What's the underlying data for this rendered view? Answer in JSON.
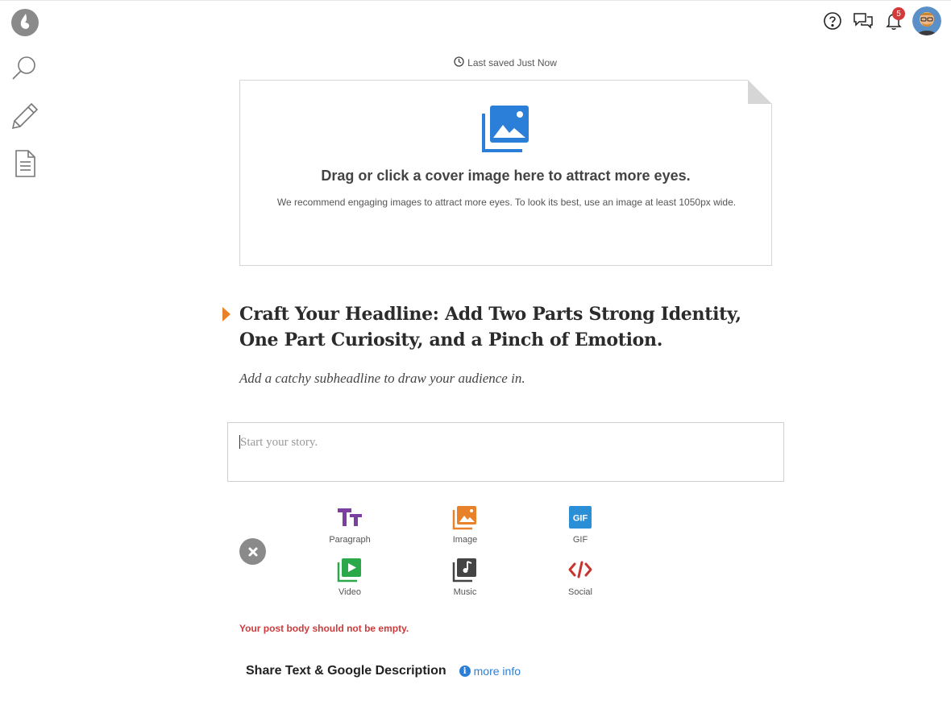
{
  "rail": {
    "items": [
      {
        "name": "logo",
        "icon": "flame-logo-icon"
      },
      {
        "name": "search",
        "icon": "search-icon"
      },
      {
        "name": "write",
        "icon": "pencil-icon"
      },
      {
        "name": "posts",
        "icon": "document-icon"
      }
    ]
  },
  "topbar": {
    "help_icon": "help-circle-icon",
    "messages_icon": "chat-bubbles-icon",
    "notifications_icon": "bell-icon",
    "notification_count": "5",
    "avatar_icon": "user-avatar"
  },
  "editor": {
    "saved_status": "Last saved Just Now",
    "cover": {
      "title": "Drag or click a cover image here to attract more eyes.",
      "description": "We recommend engaging images to attract more eyes. To look its best, use an image at least 1050px wide.",
      "icon": "image-upload-icon",
      "accent": "#2b7fd8"
    },
    "headline_line1": "Craft Your Headline: Add Two Parts Strong Identity,",
    "headline_line2": "One Part Curiosity, and a Pinch of Emotion.",
    "subheadline": "Add a catchy subheadline to draw your audience in.",
    "story_placeholder": "Start your story.",
    "error": "Your post body should not be empty.",
    "error_color": "#cc3b3b"
  },
  "toolbox": {
    "items": [
      {
        "label": "Paragraph",
        "icon": "text-size-icon",
        "color": "#7b3fa0"
      },
      {
        "label": "Image",
        "icon": "image-icon",
        "color": "#e8822a"
      },
      {
        "label": "GIF",
        "icon": "gif-icon",
        "color": "#2b8fd8"
      },
      {
        "label": "Video",
        "icon": "video-play-icon",
        "color": "#2aa84a"
      },
      {
        "label": "Music",
        "icon": "music-note-icon",
        "color": "#444444"
      },
      {
        "label": "Social",
        "icon": "code-embed-icon",
        "color": "#c8352f"
      }
    ]
  },
  "share": {
    "title": "Share Text & Google Description",
    "more_info": "more info"
  }
}
